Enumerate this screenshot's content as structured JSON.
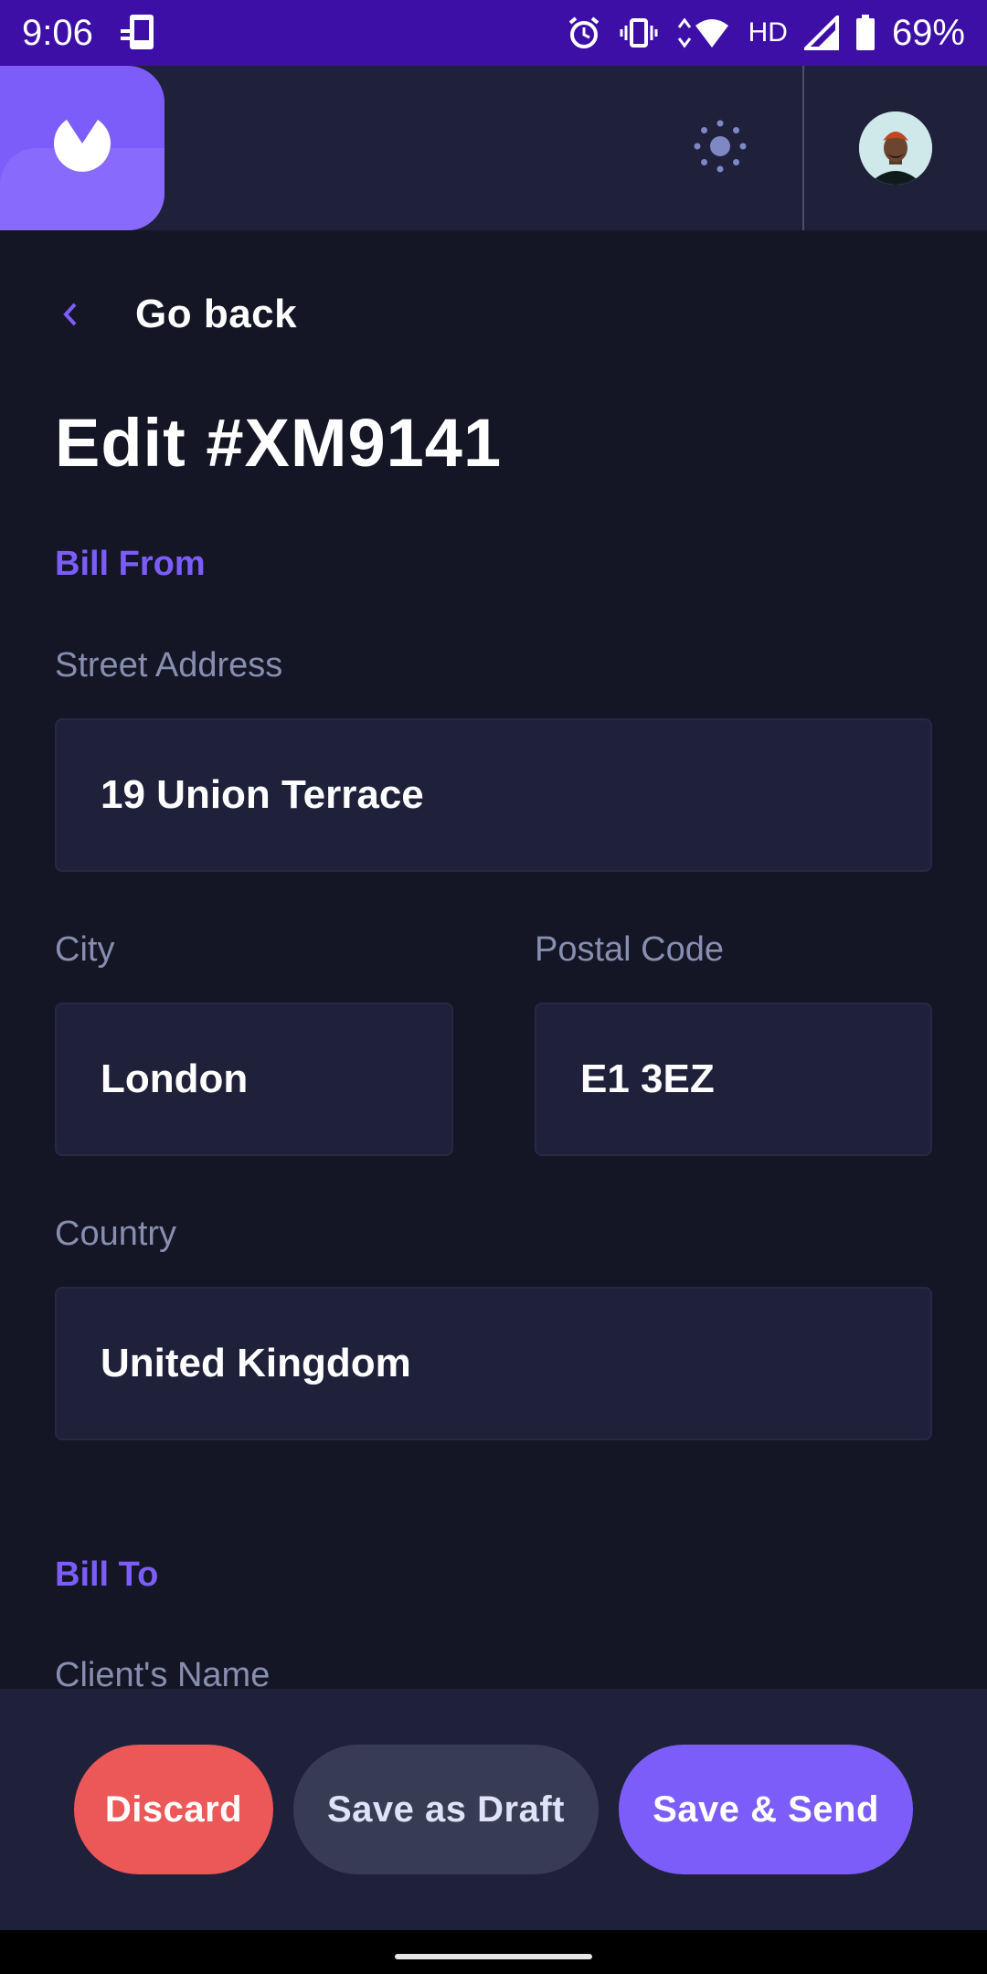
{
  "status_bar": {
    "time": "9:06",
    "network": "HD",
    "battery": "69%"
  },
  "header": {
    "logo_icon": "app-logo-icon",
    "theme_icon": "sun-icon",
    "avatar_icon": "user-avatar"
  },
  "nav": {
    "go_back": "Go back"
  },
  "page": {
    "title": "Edit #XM9141"
  },
  "bill_from": {
    "section": "Bill From",
    "street_label": "Street Address",
    "street_value": "19 Union Terrace",
    "city_label": "City",
    "city_value": "London",
    "postal_label": "Postal Code",
    "postal_value": "E1 3EZ",
    "country_label": "Country",
    "country_value": "United Kingdom"
  },
  "bill_to": {
    "section": "Bill To",
    "client_name_label": "Client's Name"
  },
  "actions": {
    "discard": "Discard",
    "save_draft": "Save as Draft",
    "save_send": "Save & Send"
  },
  "colors": {
    "accent": "#7c5dfa",
    "danger": "#ec5757",
    "background": "#141625",
    "surface": "#1e2139"
  }
}
